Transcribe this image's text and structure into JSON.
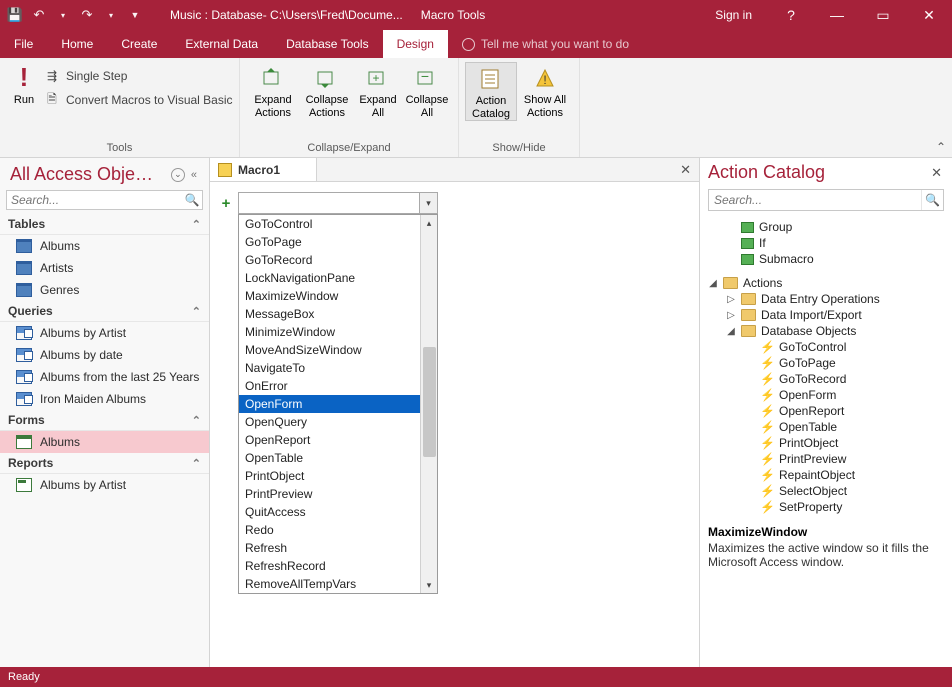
{
  "titlebar": {
    "doc_title": "Music : Database- C:\\Users\\Fred\\Docume...",
    "context_tab": "Macro Tools",
    "signin": "Sign in",
    "help": "?",
    "min": "—",
    "max": "▭",
    "close": "✕"
  },
  "tabs": {
    "file": "File",
    "home": "Home",
    "create": "Create",
    "external": "External Data",
    "dbtools": "Database Tools",
    "design": "Design",
    "tell_placeholder": "Tell me what you want to do"
  },
  "ribbon": {
    "tools_group": "Tools",
    "run": "Run",
    "single_step": "Single Step",
    "convert": "Convert Macros to Visual Basic",
    "collapse_group": "Collapse/Expand",
    "expand_actions": "Expand Actions",
    "collapse_actions": "Collapse Actions",
    "expand_all": "Expand All",
    "collapse_all": "Collapse All",
    "showhide_group": "Show/Hide",
    "action_catalog": "Action Catalog",
    "show_all": "Show All Actions"
  },
  "nav": {
    "title": "All Access Obje…",
    "search_placeholder": "Search...",
    "cat_tables": "Tables",
    "tables": [
      "Albums",
      "Artists",
      "Genres"
    ],
    "cat_queries": "Queries",
    "queries": [
      "Albums by Artist",
      "Albums by date",
      "Albums from the last 25 Years",
      "Iron Maiden Albums"
    ],
    "cat_forms": "Forms",
    "forms": [
      "Albums"
    ],
    "cat_reports": "Reports",
    "reports": [
      "Albums by Artist"
    ]
  },
  "macro": {
    "tab_label": "Macro1",
    "dropdown": [
      "GoToControl",
      "GoToPage",
      "GoToRecord",
      "LockNavigationPane",
      "MaximizeWindow",
      "MessageBox",
      "MinimizeWindow",
      "MoveAndSizeWindow",
      "NavigateTo",
      "OnError",
      "OpenForm",
      "OpenQuery",
      "OpenReport",
      "OpenTable",
      "PrintObject",
      "PrintPreview",
      "QuitAccess",
      "Redo",
      "Refresh",
      "RefreshRecord",
      "RemoveAllTempVars"
    ],
    "selected_index": 10
  },
  "catalog": {
    "title": "Action Catalog",
    "search_placeholder": "Search...",
    "flow_nodes": [
      "Group",
      "If",
      "Submacro"
    ],
    "actions_label": "Actions",
    "action_groups_collapsed": [
      "Data Entry Operations",
      "Data Import/Export"
    ],
    "dbobjects_label": "Database Objects",
    "dbobjects": [
      "GoToControl",
      "GoToPage",
      "GoToRecord",
      "OpenForm",
      "OpenReport",
      "OpenTable",
      "PrintObject",
      "PrintPreview",
      "RepaintObject",
      "SelectObject",
      "SetProperty"
    ],
    "help_title": "MaximizeWindow",
    "help_text": "Maximizes the active window so it fills the Microsoft Access window."
  },
  "status": {
    "ready": "Ready"
  }
}
